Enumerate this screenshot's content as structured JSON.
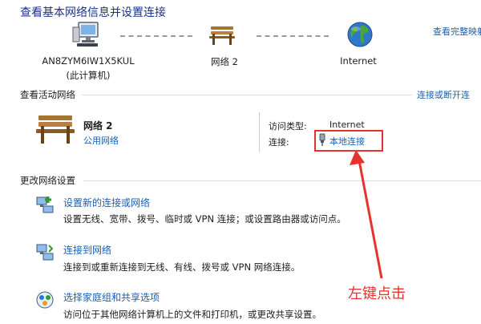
{
  "header": {
    "title": "查看基本网络信息并设置连接",
    "view_full_map_link": "查看完整映射"
  },
  "network_map": {
    "computer": {
      "name": "AN8ZYM6IW1X5KUL",
      "sub": "(此计算机)",
      "icon": "computer-icon"
    },
    "network": {
      "name": "网络  2",
      "icon": "bench-icon"
    },
    "internet": {
      "name": "Internet",
      "icon": "globe-icon"
    }
  },
  "active_networks": {
    "heading": "查看活动网络",
    "connect_disconnect_link": "连接或断开连",
    "network_name": "网络  2",
    "network_type_link": "公用网络",
    "access_type_label": "访问类型:",
    "access_type_value": "Internet",
    "connection_label": "连接:",
    "connection_link": "本地连接"
  },
  "change_settings": {
    "heading": "更改网络设置",
    "items": [
      {
        "label": "设置新的连接或网络",
        "desc": "设置无线、宽带、拨号、临时或 VPN 连接；或设置路由器或访问点。",
        "icon": "new-connection-icon"
      },
      {
        "label": "连接到网络",
        "desc": "连接到或重新连接到无线、有线、拨号或 VPN 网络连接。",
        "icon": "connect-network-icon"
      },
      {
        "label": "选择家庭组和共享选项",
        "desc": "访问位于其他网络计算机上的文件和打印机，或更改共享设置。",
        "icon": "homegroup-icon"
      }
    ]
  },
  "annotation": {
    "text": "左键点击"
  },
  "colors": {
    "link": "#1a5fb4",
    "title": "#1e3287",
    "annotation": "#e8322d"
  }
}
